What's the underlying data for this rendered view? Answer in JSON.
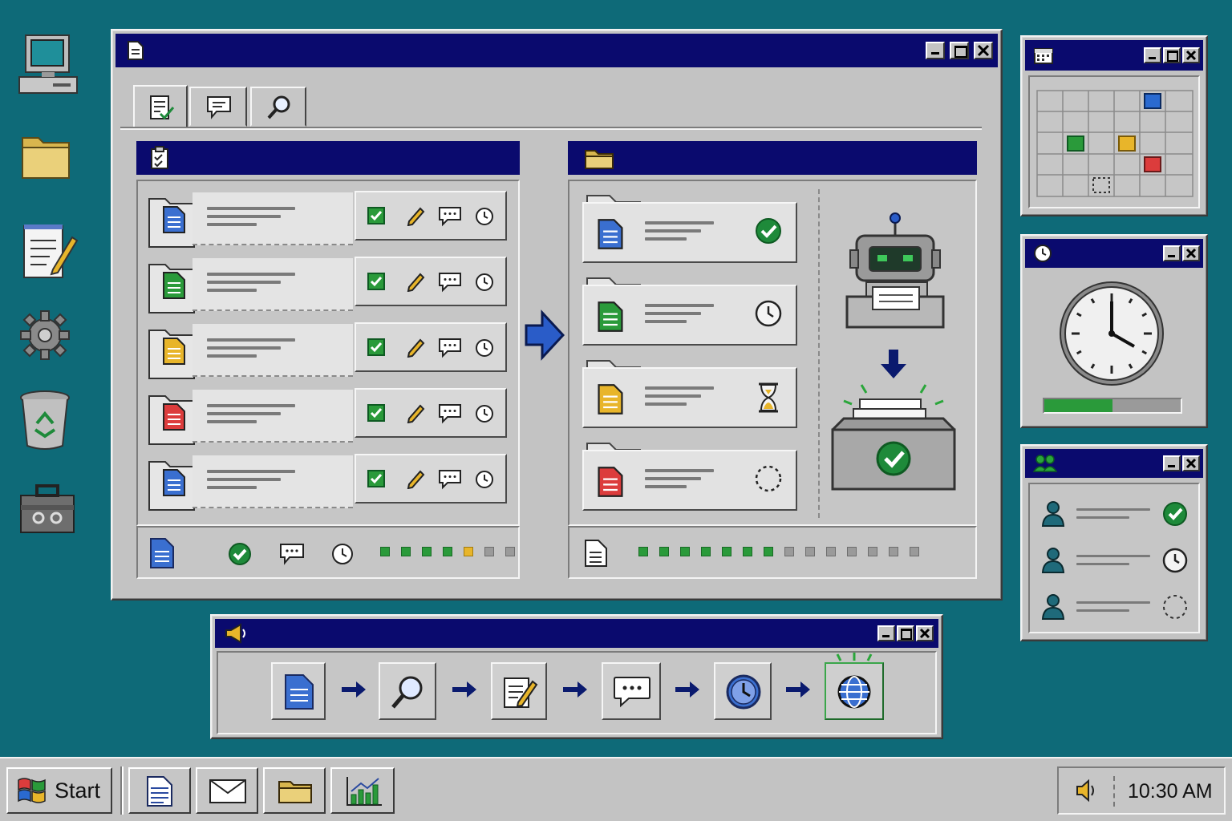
{
  "desktop": {
    "icons": [
      "computer-icon",
      "folder-icon",
      "notepad-icon",
      "settings-gear-icon",
      "recycle-bin-icon",
      "toolbox-icon"
    ]
  },
  "main_window": {
    "title_icon": "document-icon",
    "tabs": [
      "tasks-tab-icon",
      "comments-tab-icon",
      "search-tab-icon"
    ],
    "left_panel": {
      "header_icon": "clipboard-checklist-icon",
      "rows": [
        {
          "doc_color": "#3a6fd0",
          "checked": true
        },
        {
          "doc_color": "#2a9a3a",
          "checked": true
        },
        {
          "doc_color": "#e8b52a",
          "checked": true
        },
        {
          "doc_color": "#dc3c3c",
          "checked": true
        },
        {
          "doc_color": "#3a6fd0",
          "checked": true
        }
      ],
      "progress": [
        "done",
        "done",
        "done",
        "done",
        "active",
        "pending",
        "pending"
      ]
    },
    "right_panel": {
      "header_icon": "folder-icon",
      "items": [
        {
          "doc_color": "#3a6fd0",
          "status": "complete"
        },
        {
          "doc_color": "#2a9a3a",
          "status": "scheduled"
        },
        {
          "doc_color": "#e8b52a",
          "status": "in-progress"
        },
        {
          "doc_color": "#dc3c3c",
          "status": "pending"
        }
      ],
      "progress": [
        "done",
        "done",
        "done",
        "done",
        "done",
        "done",
        "done",
        "pending",
        "pending",
        "pending",
        "pending",
        "pending",
        "pending",
        "pending"
      ]
    }
  },
  "calendar_window": {
    "title_icon": "calendar-icon"
  },
  "clock_window": {
    "title_icon": "clock-icon",
    "progress": 0.5
  },
  "users_window": {
    "title_icon": "users-icon",
    "users": [
      {
        "status": "complete"
      },
      {
        "status": "scheduled"
      },
      {
        "status": "pending"
      }
    ]
  },
  "pipeline_window": {
    "title_icon": "megaphone-icon",
    "steps": [
      "document-icon",
      "search-icon",
      "edit-icon",
      "chat-icon",
      "clock-icon",
      "globe-icon"
    ]
  },
  "taskbar": {
    "start_label": "Start",
    "apps": [
      "document-icon",
      "mail-icon",
      "folder-icon",
      "chart-icon"
    ],
    "clock": "10:30 AM"
  },
  "colors": {
    "desktop": "#0e6a78",
    "titlebar": "#0a0a6e",
    "chrome": "#c3c3c3",
    "success": "#1e8a3a"
  }
}
